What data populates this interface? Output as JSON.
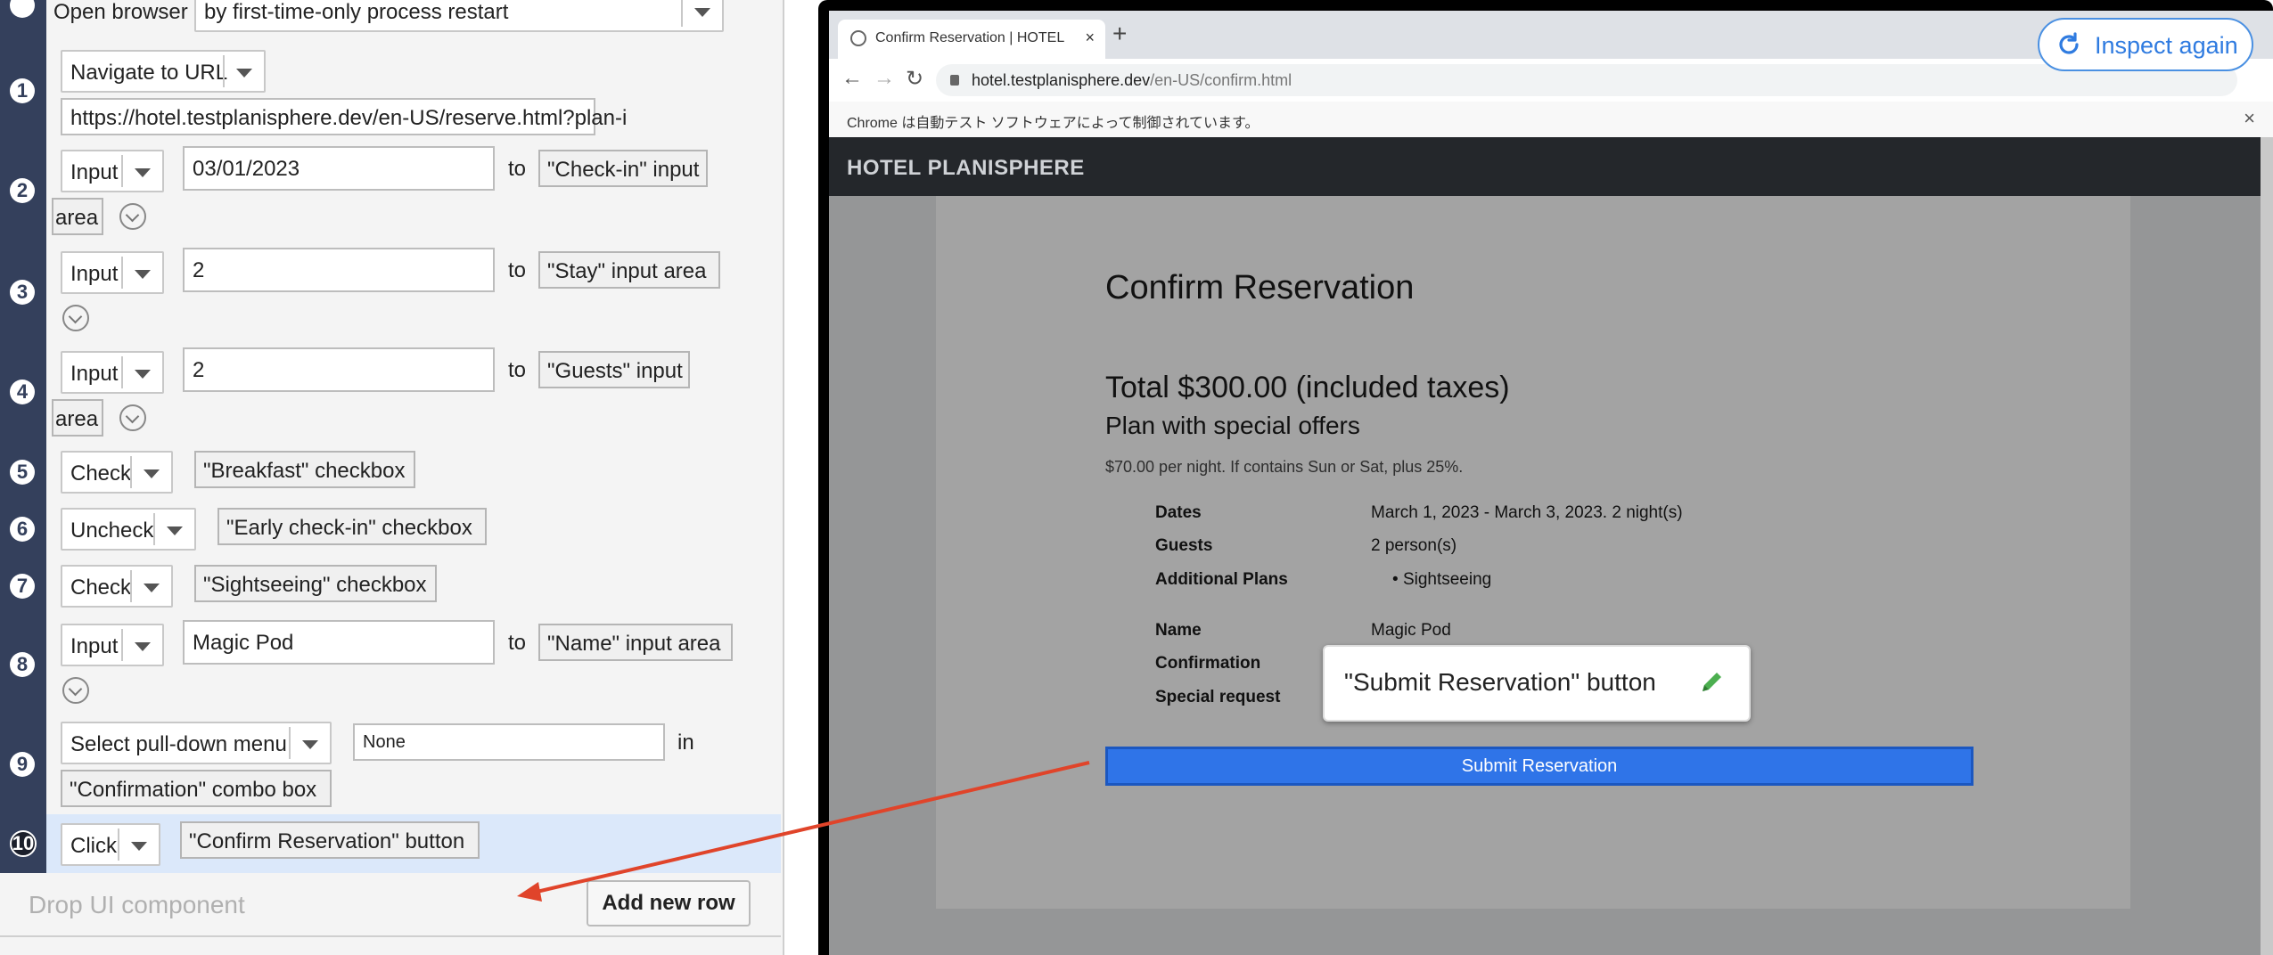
{
  "steps": {
    "row0": {
      "action": "Open browser",
      "option": "by first-time-only process restart"
    },
    "row1": {
      "num": "1",
      "action": "Navigate to URL",
      "url": "https://hotel.testplanisphere.dev/en-US/reserve.html?plan-i"
    },
    "row2": {
      "num": "2",
      "action": "Input",
      "value": "03/01/2023",
      "to": "to",
      "target": "\"Check-in\" input",
      "target_wrap": "area"
    },
    "row3": {
      "num": "3",
      "action": "Input",
      "value": "2",
      "to": "to",
      "target": "\"Stay\" input area"
    },
    "row4": {
      "num": "4",
      "action": "Input",
      "value": "2",
      "to": "to",
      "target": "\"Guests\" input",
      "target_wrap": "area"
    },
    "row5": {
      "num": "5",
      "action": "Check",
      "target": "\"Breakfast\" checkbox"
    },
    "row6": {
      "num": "6",
      "action": "Uncheck",
      "target": "\"Early check-in\" checkbox"
    },
    "row7": {
      "num": "7",
      "action": "Check",
      "target": "\"Sightseeing\" checkbox"
    },
    "row8": {
      "num": "8",
      "action": "Input",
      "value": "Magic Pod",
      "to": "to",
      "target": "\"Name\" input area"
    },
    "row9": {
      "num": "9",
      "action": "Select pull-down menu",
      "value": "None",
      "in": "in",
      "target": "\"Confirmation\" combo box"
    },
    "row10": {
      "num": "10",
      "action": "Click",
      "target": "\"Confirm Reservation\" button"
    }
  },
  "dropzone": {
    "placeholder": "Drop UI component",
    "add_row": "Add new row"
  },
  "browser": {
    "tab_title": "Confirm Reservation | HOTEL",
    "new_tab": "+",
    "url_host": "hotel.testplanisphere.dev",
    "url_path": "/en-US/confirm.html",
    "infobar": "Chrome は自動テスト ソフトウェアによって制御されています。",
    "close": "×"
  },
  "page": {
    "brand": "HOTEL PLANISPHERE",
    "heading": "Confirm Reservation",
    "total": "Total $300.00 (included taxes)",
    "plan": "Plan with special offers",
    "plan_note": "$70.00 per night. If contains Sun or Sat, plus 25%.",
    "details": {
      "dates_k": "Dates",
      "dates_v": "March 1, 2023 - March 3, 2023. 2 night(s)",
      "guests_k": "Guests",
      "guests_v": "2 person(s)",
      "plans_k": "Additional Plans",
      "plans_v": "Sightseeing",
      "name_k": "Name",
      "name_v": "Magic Pod",
      "conf_k": "Confirmation",
      "req_k": "Special request"
    },
    "submit": "Submit Reservation"
  },
  "bubble": {
    "label": "\"Submit Reservation\" button"
  },
  "inspect": {
    "label": "Inspect again"
  },
  "colors": {
    "gutter": "#34405c",
    "selected_row": "#dbe8fa",
    "accent": "#2f7be0",
    "arrow": "#e0442a",
    "submit": "#2f74e8"
  }
}
